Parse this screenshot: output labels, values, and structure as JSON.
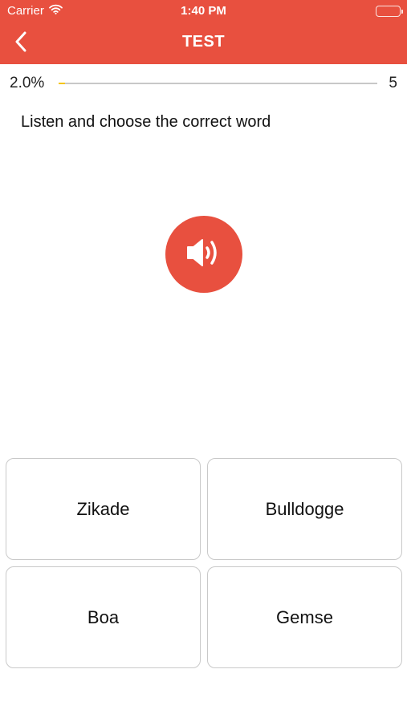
{
  "status_bar": {
    "carrier": "Carrier",
    "time": "1:40 PM"
  },
  "nav": {
    "title": "TEST",
    "back_icon": "chevron-left-icon"
  },
  "progress": {
    "percent_label": "2.0%",
    "fraction": 0.02,
    "count": "5"
  },
  "question": {
    "prompt": "Listen and choose the correct word",
    "audio_icon": "speaker-icon"
  },
  "answers": [
    {
      "label": "Zikade"
    },
    {
      "label": "Bulldogge"
    },
    {
      "label": "Boa"
    },
    {
      "label": "Gemse"
    }
  ],
  "colors": {
    "accent": "#e8503f",
    "progress": "#f4c400",
    "track": "#c8c8c8"
  }
}
